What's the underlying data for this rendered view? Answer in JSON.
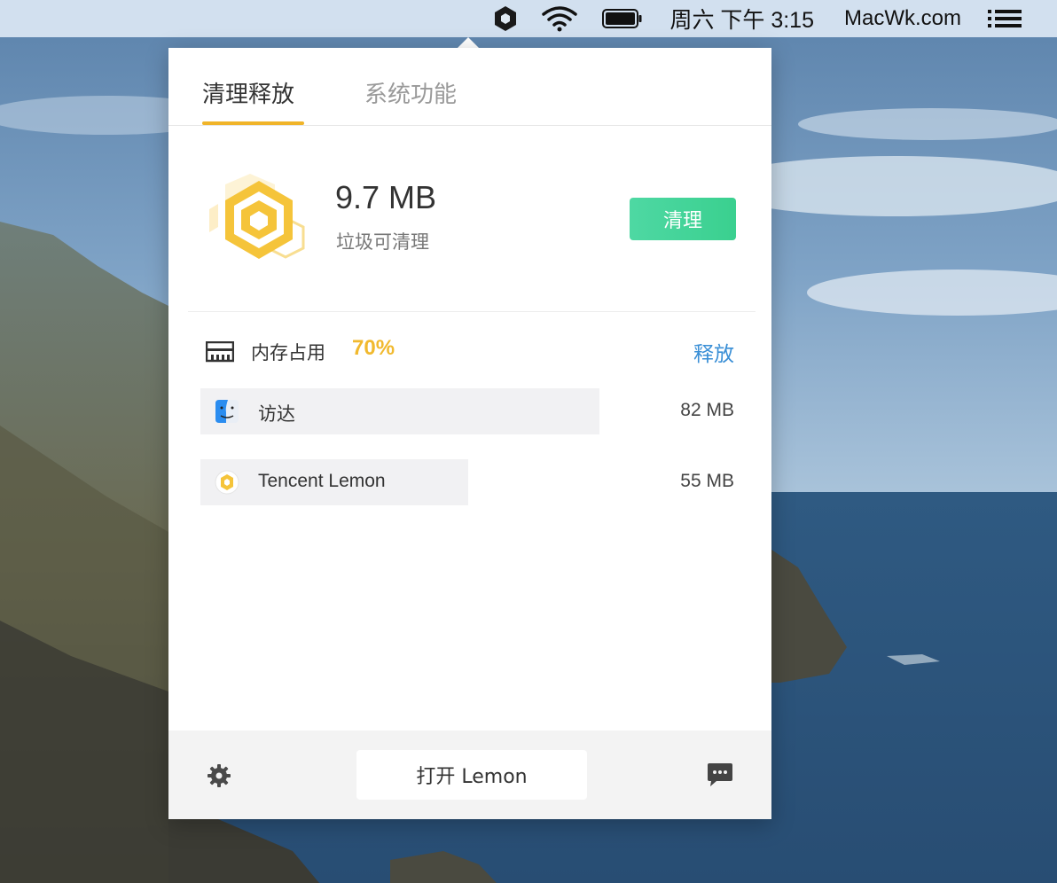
{
  "menubar": {
    "items": [
      "lemon-icon",
      "wifi-icon",
      "battery-icon"
    ],
    "clock": "周六 下午 3:15",
    "site": "MacWk.com",
    "menu_icon": "list-icon"
  },
  "popover": {
    "tabs": [
      {
        "label": "清理释放",
        "active": true
      },
      {
        "label": "系统功能",
        "active": false
      }
    ],
    "accent_color": "#f0b429",
    "junk": {
      "size": "9.7 MB",
      "label": "垃圾可清理",
      "clean_button": "清理",
      "clean_button_color": "#3ad08f"
    },
    "memory": {
      "label": "内存占用",
      "percent": "70%",
      "percent_color": "#f1b92e",
      "release": "释放",
      "release_color": "#3a8fd6"
    },
    "processes": [
      {
        "name": "访达",
        "size": "82 MB",
        "icon": "finder-icon"
      },
      {
        "name": "Tencent Lemon",
        "size": "55 MB",
        "icon": "lemon-app-icon"
      }
    ],
    "footer": {
      "settings_icon": "gear-icon",
      "open_button": "打开 Lemon",
      "feedback_icon": "chat-icon"
    }
  }
}
